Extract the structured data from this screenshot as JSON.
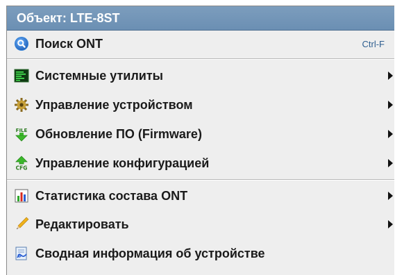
{
  "menu": {
    "header_prefix": "Объект:",
    "object_name": "LTE-8ST",
    "items": [
      {
        "label": "Поиск ONT",
        "shortcut": "Ctrl-F",
        "icon": "search-icon"
      },
      {
        "label": "Системные утилиты",
        "icon": "terminal-icon",
        "submenu": true
      },
      {
        "label": "Управление устройством",
        "icon": "gear-icon",
        "submenu": true
      },
      {
        "label": "Обновление ПО (Firmware)",
        "icon": "file-download-icon",
        "submenu": true
      },
      {
        "label": "Управление конфигурацией",
        "icon": "cfg-icon",
        "submenu": true
      },
      {
        "label": "Статистика состава ONT",
        "icon": "bar-chart-icon",
        "submenu": true
      },
      {
        "label": "Редактировать",
        "icon": "pencil-icon",
        "submenu": true
      },
      {
        "label": "Сводная информация об устройстве",
        "icon": "info-document-icon",
        "submenu": false
      }
    ]
  },
  "colors": {
    "header_bg": "#6b8fb3",
    "menu_bg": "#eeeeee",
    "shortcut_text": "#2f5f90"
  }
}
